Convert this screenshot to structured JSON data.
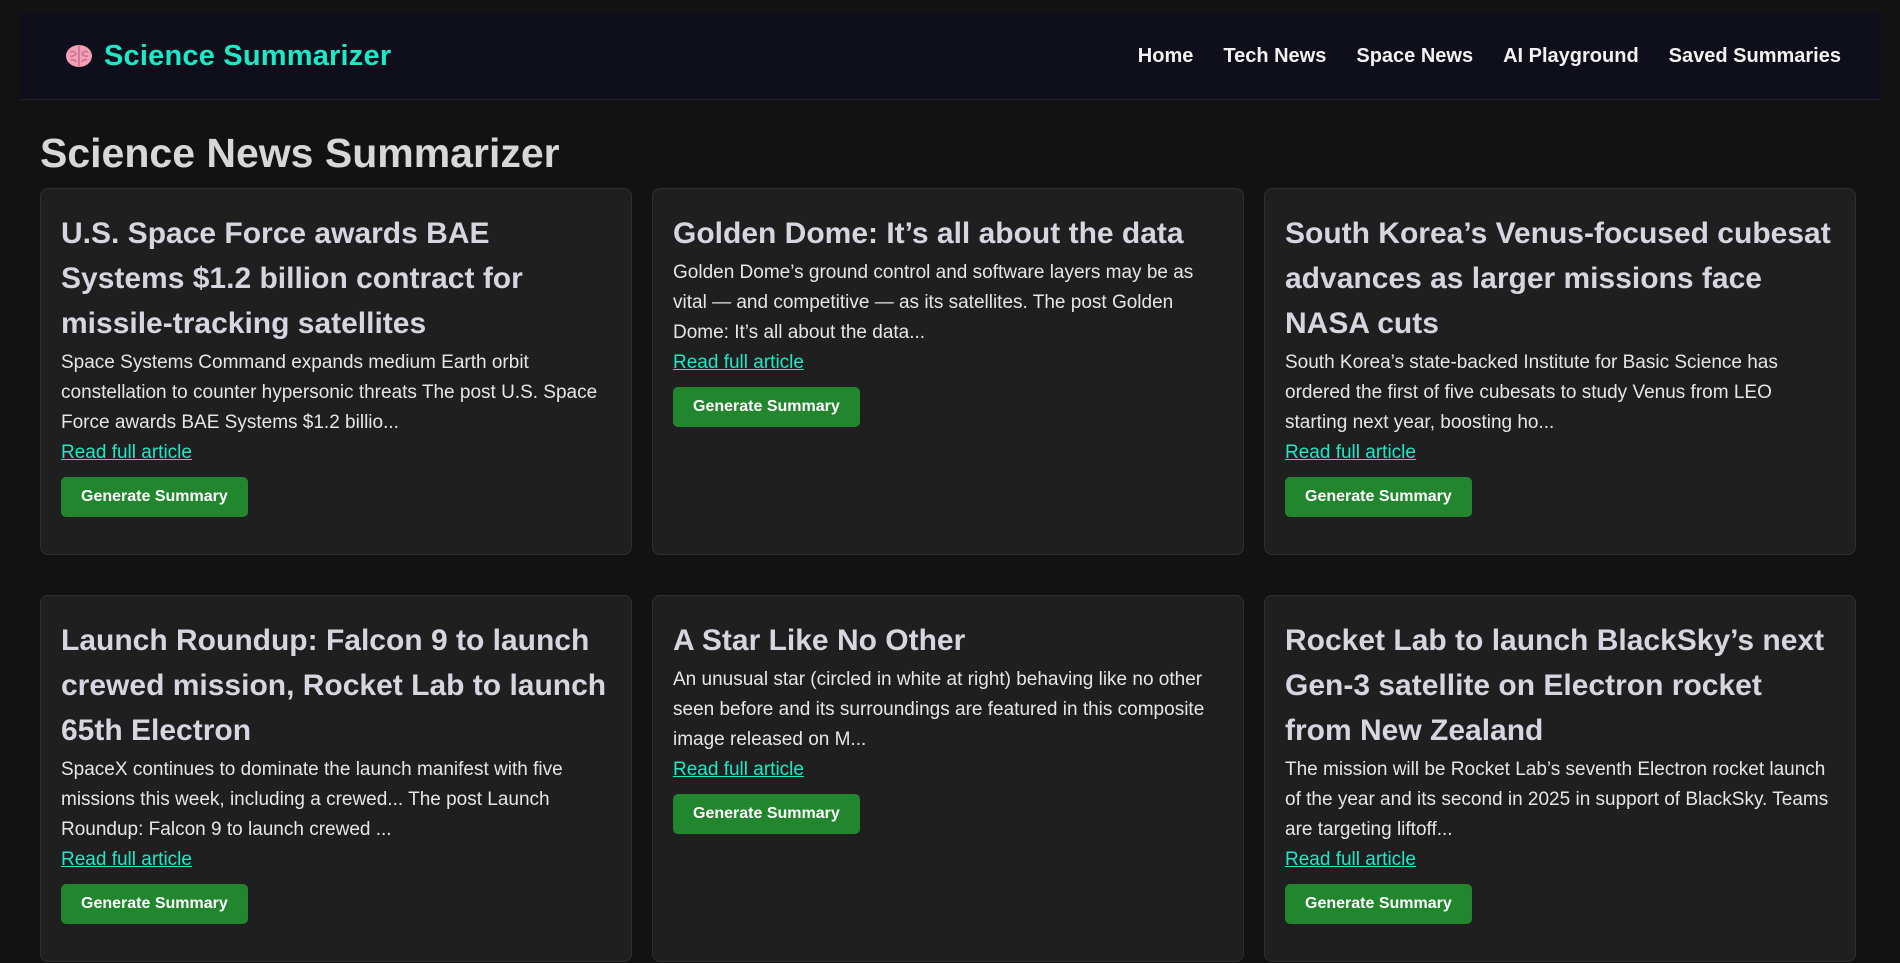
{
  "header": {
    "brand_title": "Science Summarizer",
    "brand_icon": "brain-icon",
    "accent_color": "#1de9c8",
    "nav": [
      {
        "label": "Home"
      },
      {
        "label": "Tech News"
      },
      {
        "label": "Space News"
      },
      {
        "label": "AI Playground"
      },
      {
        "label": "Saved Summaries"
      }
    ]
  },
  "main": {
    "title": "Science News Summarizer",
    "link_label": "Read full article",
    "button_label": "Generate Summary",
    "button_color": "#22862f",
    "articles": [
      {
        "title": "U.S. Space Force awards BAE Systems $1.2 billion contract for missile-tracking satellites",
        "description": "Space Systems Command expands medium Earth orbit constellation to counter hypersonic threats The post U.S. Space Force awards BAE Systems $1.2 billio..."
      },
      {
        "title": "Golden Dome: It’s all about the data",
        "description": "Golden Dome’s ground control and software layers may be as vital — and competitive — as its satellites. The post Golden Dome: It’s all about the data..."
      },
      {
        "title": "South Korea’s Venus-focused cubesat advances as larger missions face NASA cuts",
        "description": "South Korea’s state-backed Institute for Basic Science has ordered the first of five cubesats to study Venus from LEO starting next year, boosting ho..."
      },
      {
        "title": "Launch Roundup: Falcon 9 to launch crewed mission, Rocket Lab to launch 65th Electron",
        "description": "SpaceX continues to dominate the launch manifest with five missions this week, including a crewed... The post Launch Roundup: Falcon 9 to launch crewed ..."
      },
      {
        "title": "A Star Like No Other",
        "description": "An unusual star (circled in white at right) behaving like no other seen before and its surroundings are featured in this composite image released on M..."
      },
      {
        "title": "Rocket Lab to launch BlackSky’s next Gen-3 satellite on Electron rocket from New Zealand",
        "description": "The mission will be Rocket Lab’s seventh Electron rocket launch of the year and its second in 2025 in support of BlackSky. Teams are targeting liftoff..."
      }
    ]
  }
}
